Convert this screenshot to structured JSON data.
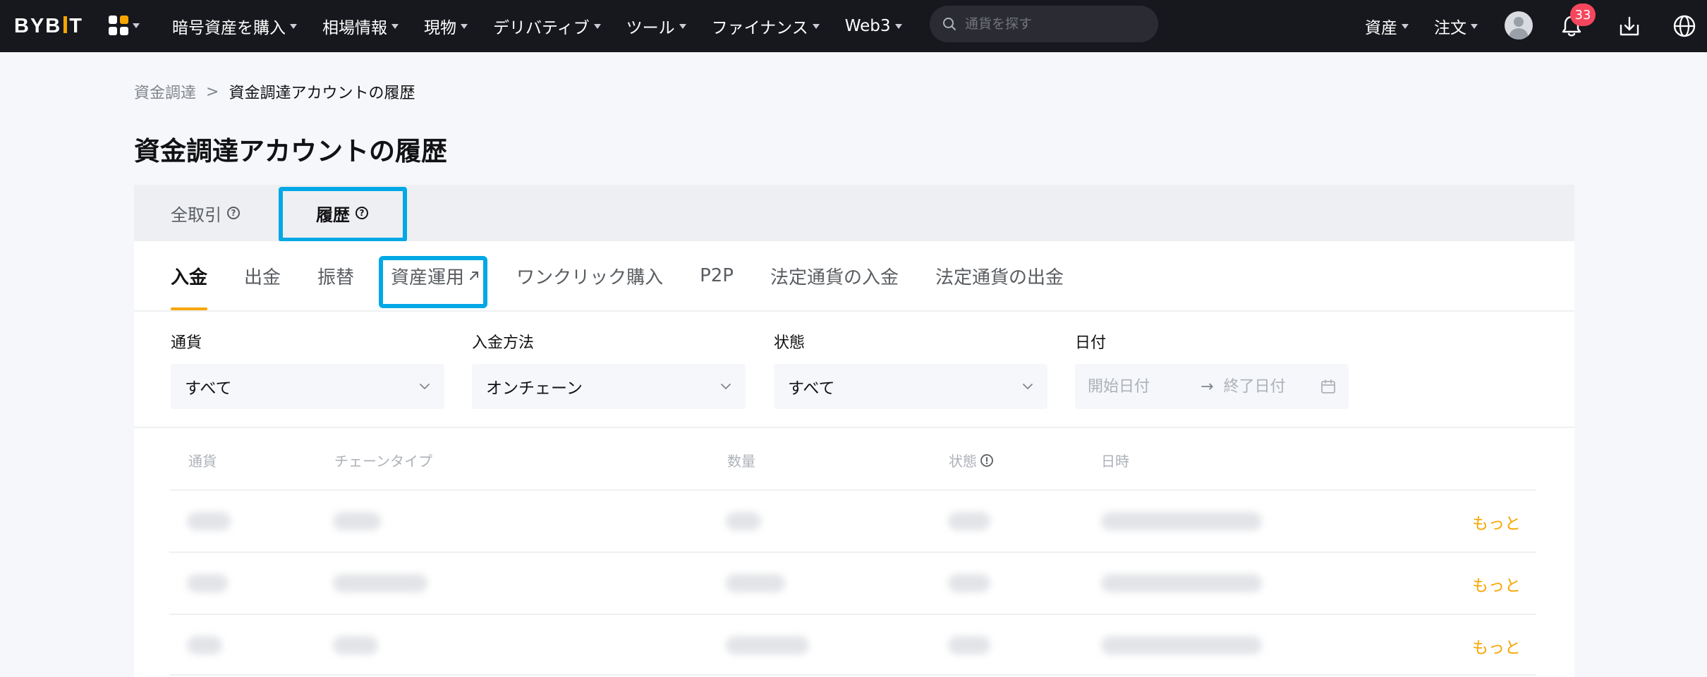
{
  "brand": {
    "logo": "BYBIT",
    "accent": "#f7a600",
    "nav_bg": "#17181e",
    "highlight": "#00a8e6"
  },
  "nav": {
    "items": [
      {
        "label": "暗号資産を購入"
      },
      {
        "label": "相場情報"
      },
      {
        "label": "現物"
      },
      {
        "label": "デリバティブ"
      },
      {
        "label": "ツール"
      },
      {
        "label": "ファイナンス"
      },
      {
        "label": "Web3"
      }
    ],
    "search_placeholder": "通貨を探す",
    "assets_label": "資産",
    "orders_label": "注文",
    "notification_count": "33"
  },
  "breadcrumb": {
    "parent": "資金調達",
    "separator": ">",
    "current": "資金調達アカウントの履歴"
  },
  "page_title": "資金調達アカウントの履歴",
  "main_tabs": [
    {
      "label": "全取引",
      "active": false
    },
    {
      "label": "履歴",
      "active": true
    }
  ],
  "sub_tabs": [
    {
      "label": "入金",
      "active": true
    },
    {
      "label": "出金"
    },
    {
      "label": "振替"
    },
    {
      "label": "資産運用",
      "external": true
    },
    {
      "label": "ワンクリック購入"
    },
    {
      "label": "P2P"
    },
    {
      "label": "法定通貨の入金"
    },
    {
      "label": "法定通貨の出金"
    }
  ],
  "filters": {
    "currency": {
      "label": "通貨",
      "value": "すべて"
    },
    "method": {
      "label": "入金方法",
      "value": "オンチェーン"
    },
    "status": {
      "label": "状態",
      "value": "すべて"
    },
    "date": {
      "label": "日付",
      "start_placeholder": "開始日付",
      "end_placeholder": "終了日付",
      "arrow": "→"
    }
  },
  "table": {
    "headers": [
      "通貨",
      "チェーンタイプ",
      "数量",
      "状態",
      "日時"
    ],
    "rows": [
      {
        "more": "もっと"
      },
      {
        "more": "もっと"
      },
      {
        "more": "もっと"
      }
    ]
  }
}
